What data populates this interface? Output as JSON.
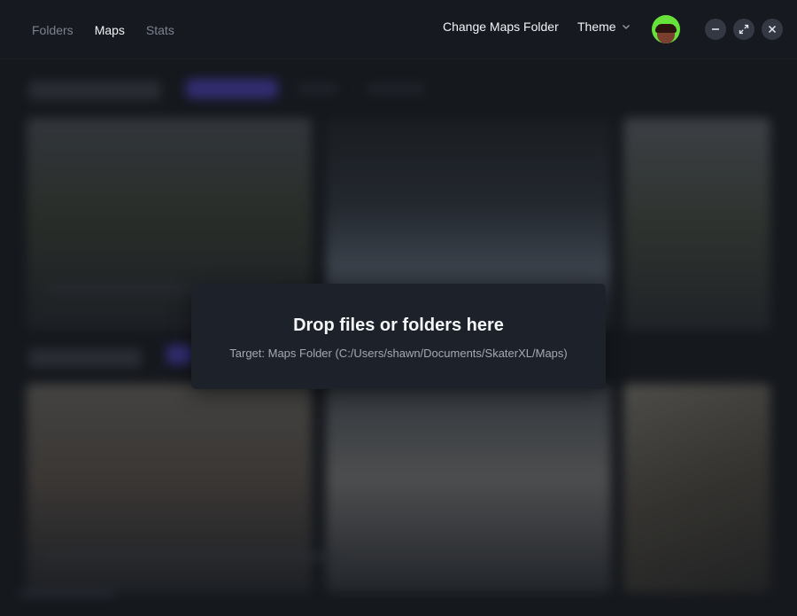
{
  "nav": {
    "items": [
      {
        "label": "Folders",
        "active": false
      },
      {
        "label": "Maps",
        "active": true
      },
      {
        "label": "Stats",
        "active": false
      }
    ]
  },
  "header": {
    "change_folder_label": "Change Maps Folder",
    "theme_label": "Theme",
    "theme_icon": "chevron-down-icon"
  },
  "window_controls": {
    "minimize_icon": "minimize-icon",
    "maximize_icon": "maximize-icon",
    "close_icon": "close-icon"
  },
  "drop_overlay": {
    "title": "Drop files or folders here",
    "target": "Target: Maps Folder (C:/Users/shawn/Documents/SkaterXL/Maps)"
  },
  "colors": {
    "background": "#15181d",
    "overlay_panel": "#1d222a",
    "avatar_bg": "#66e23a",
    "accent_pill": "#4b3fb8"
  }
}
